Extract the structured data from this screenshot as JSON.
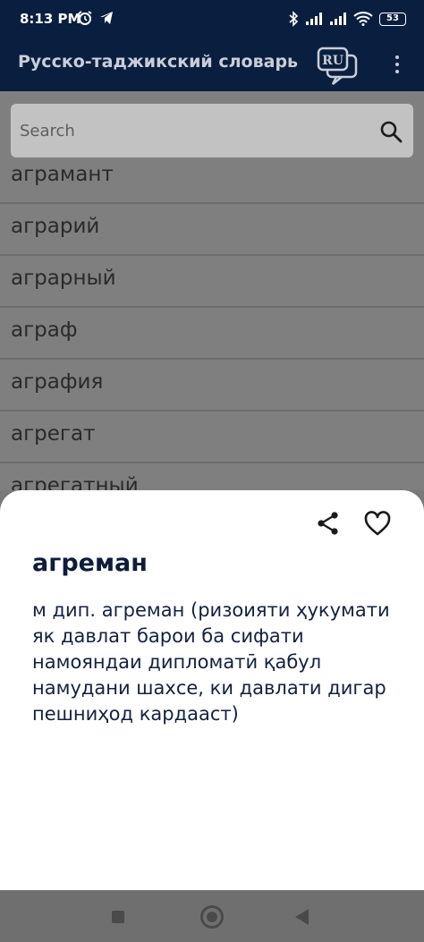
{
  "status_bar": {
    "time": "8:13 PM",
    "battery": "53",
    "left_icons": [
      "alarm-icon",
      "telegram-icon"
    ],
    "right_icons": [
      "bluetooth-icon",
      "signal-icon",
      "signal-icon",
      "wifi-icon",
      "battery-icon"
    ]
  },
  "app_bar": {
    "title": "Русско-таджикский словарь",
    "lang_label": "RU"
  },
  "search": {
    "placeholder": "Search"
  },
  "word_list": [
    "аграмант",
    "аграрий",
    "аграрный",
    "аграф",
    "аграфия",
    "агрегат",
    "агрегатный"
  ],
  "entry": {
    "word": "агреман",
    "definition": "м дип. агреман (ризоияти ҳукумати як давлат барои ба сифати намояндаи дипломатӣ қабул намудани шахсе, ки давлати дигар пешниҳод кардааст)"
  },
  "colors": {
    "app_bar": "#0a1f3f",
    "sheet": "#ffffff",
    "word": "#0f1c3a"
  }
}
